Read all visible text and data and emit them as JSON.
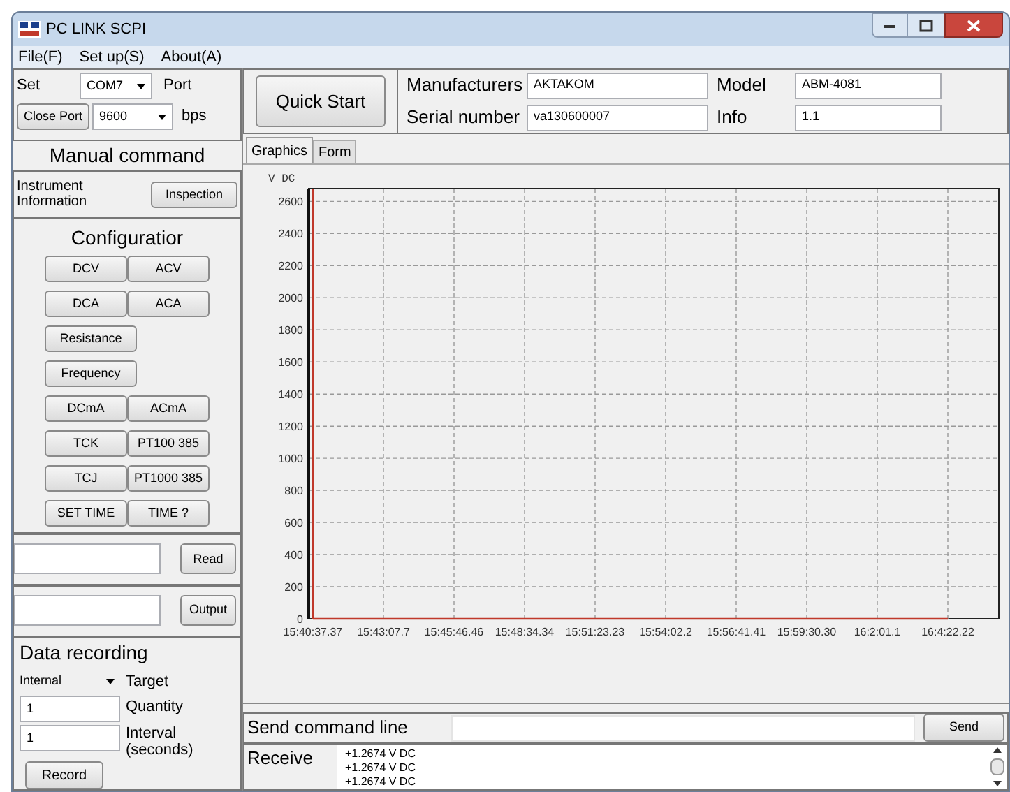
{
  "window": {
    "title": "PC LINK SCPI"
  },
  "menu": [
    {
      "label": "File(F)"
    },
    {
      "label": "Set up(S)"
    },
    {
      "label": "About(A)"
    }
  ],
  "port_settings": {
    "label": "Set",
    "port": "COM7",
    "port_label": "Port",
    "close_button": "Close Port",
    "baud": "9600",
    "baud_label": "bps"
  },
  "manual_command": {
    "title": "Manual command",
    "instrument_label": "Instrument Information",
    "inspection_button": "Inspection"
  },
  "configuration": {
    "title": "Configuratior",
    "rows": [
      [
        "DCV",
        "ACV"
      ],
      [
        "DCA",
        "ACA"
      ],
      [
        "Resistance"
      ],
      [
        "Frequency"
      ],
      [
        "DCmA",
        "ACmA"
      ],
      [
        "TCK",
        "PT100 385"
      ],
      [
        "TCJ",
        "PT1000 385"
      ],
      [
        "SET TIME",
        "TIME ?"
      ]
    ]
  },
  "read": {
    "button": "Read"
  },
  "output": {
    "button": "Output"
  },
  "data_recording": {
    "title": "Data recording",
    "target": "Internal",
    "target_label": "Target",
    "quantity": "1",
    "quantity_label": "Quantity",
    "interval": "1",
    "interval_label": "Interval (seconds)",
    "record_button": "Record"
  },
  "device_info": {
    "quick_start": "Quick Start",
    "fields": [
      {
        "label": "Manufacturers",
        "value": "AKTAKOM"
      },
      {
        "label": "Model",
        "value": "ABM-4081"
      },
      {
        "label": "Serial number",
        "value": "va130600007"
      },
      {
        "label": "Info",
        "value": "1.1"
      }
    ]
  },
  "tabs": [
    {
      "label": "Graphics",
      "selected": true
    },
    {
      "label": "Form",
      "selected": false
    }
  ],
  "chart_data": {
    "type": "line",
    "ylabel": "V DC",
    "categories": [
      "15:40:37.37",
      "15:43:07.7",
      "15:45:46.46",
      "15:48:34.34",
      "15:51:23.23",
      "15:54:02.2",
      "15:56:41.41",
      "15:59:30.30",
      "16:2:01.1",
      "16:4:22.22"
    ],
    "series": [
      {
        "color": "#c0392b",
        "values": [
          0,
          0,
          0,
          0,
          0,
          0,
          0,
          0,
          0,
          0
        ]
      }
    ],
    "ylim": [
      0,
      2680
    ],
    "grid": true,
    "ref_lines": [
      {
        "axis": "x",
        "value": "15:40:37.37",
        "color": "#c0392b"
      }
    ],
    "yticks": [
      0,
      200,
      400,
      600,
      800,
      1000,
      1200,
      1400,
      1600,
      1800,
      2000,
      2200,
      2400,
      2600
    ]
  },
  "command": {
    "label": "Send command line",
    "button": "Send"
  },
  "receive": {
    "label": "Receive",
    "lines": [
      "+1.2674 V DC",
      "+1.2674 V DC",
      "+1.2674 V DC"
    ]
  }
}
